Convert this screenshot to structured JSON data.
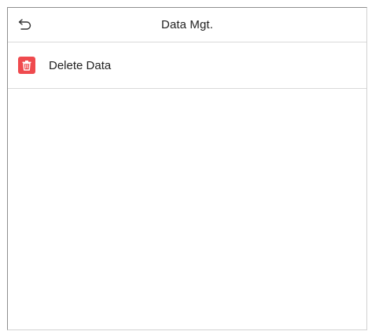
{
  "header": {
    "title": "Data Mgt.",
    "back_icon": "back-arrow-icon"
  },
  "menu": {
    "items": [
      {
        "label": "Delete Data",
        "icon": "trash-icon",
        "icon_color": "#ef4a4e"
      }
    ]
  }
}
